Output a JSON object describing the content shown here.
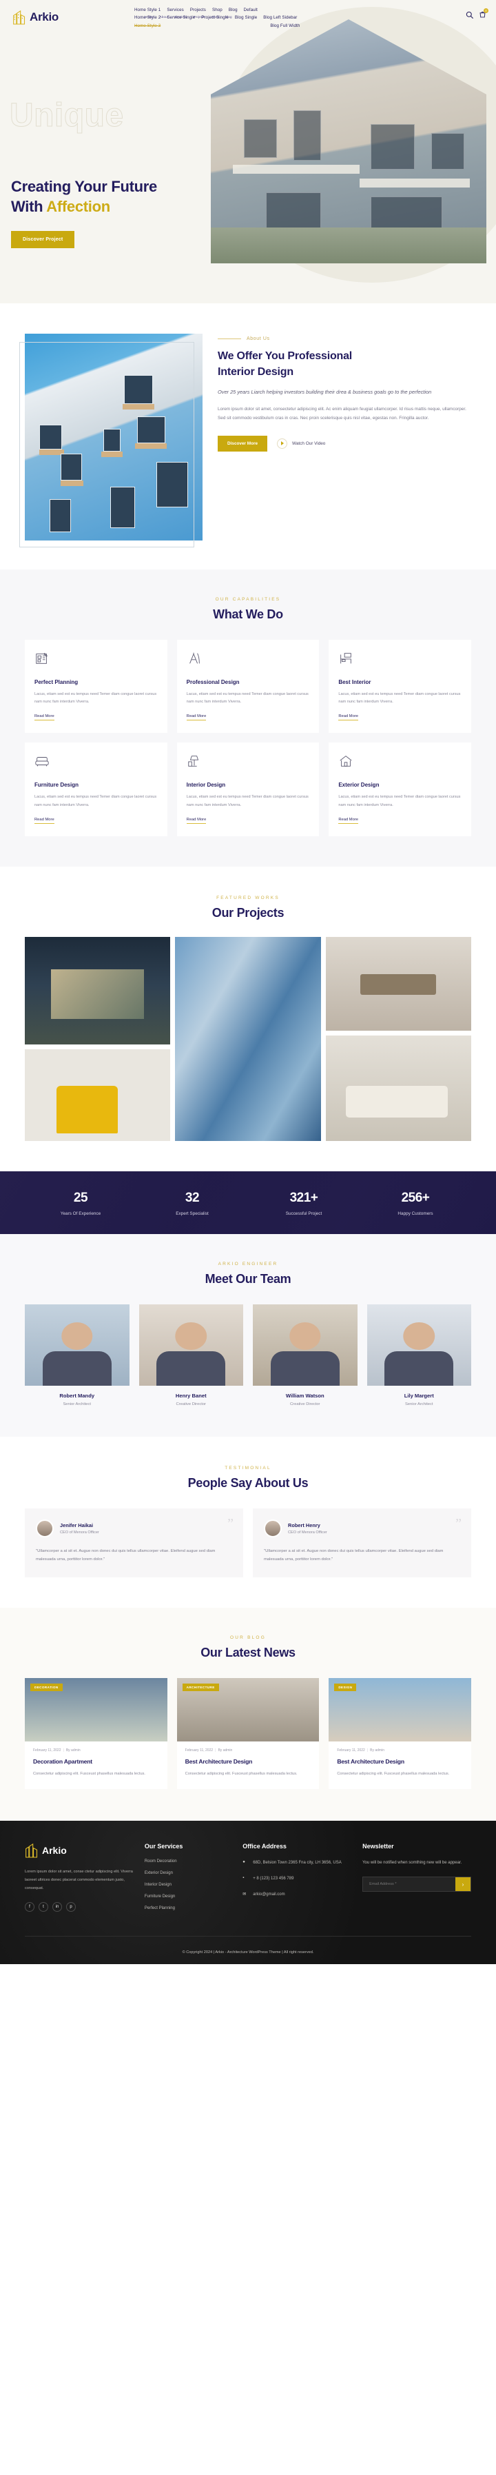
{
  "brand": {
    "name": "Arkio",
    "icon": "building-logo-icon"
  },
  "header": {
    "nav_primary": [
      "Home Style 1",
      "Services",
      "Projects",
      "Shop",
      "Blog",
      "Default"
    ],
    "nav_secondary": [
      "Home Style 2",
      "Service Single",
      "Project Single",
      "Blog Single",
      "Blog Left Sidebar"
    ],
    "nav_overlay": [
      "Home",
      "About",
      "Services",
      "Projects",
      "Shop",
      "Blog"
    ],
    "nav_tertiary": [
      "Home Style 3",
      "Blog Full Width"
    ],
    "nav_extra": "Home Style 5",
    "search_icon": "search-icon",
    "cart_icon": "cart-icon",
    "cart_count": "0"
  },
  "hero": {
    "outline_word": "Unique",
    "title_line1": "Creating Your Future",
    "title_line2_plain": "With ",
    "title_line2_accent": "Affection",
    "cta": "Discover Project"
  },
  "about": {
    "eyebrow": "About Us",
    "title_line1": "We Offer You Professional",
    "title_line2": "Interior Design",
    "lead": "Over 25 years Liarch helping investors building their drea & business goals go to the perfection",
    "body": "Lorem ipsum dolor sit amet, consectetur adipiscing elit. Ac enim aliquam feugiat ullamcorper. Id risus mattis neque, ullamcorper. Sed sit commodo vestibulum cras in cras. Nec proin scelerisque quis nisl vitae, egestas non. Fringilla auctor.",
    "cta": "Discover More",
    "video_label": "Watch Our Video",
    "play_icon": "play-icon"
  },
  "capabilities": {
    "eyebrow": "OUR CAPABILITIES",
    "title": "What We Do",
    "read_more": "Read More",
    "body": "Lacus, etiam sed est eu tempus need Temer diam congue laoret cursus nam nunc fam interdum Viverra.",
    "cards": [
      {
        "title": "Perfect Planning",
        "icon": "blueprint-icon"
      },
      {
        "title": "Professional Design",
        "icon": "compass-icon"
      },
      {
        "title": "Best Interior",
        "icon": "bed-icon"
      },
      {
        "title": "Furniture Design",
        "icon": "sofa-icon"
      },
      {
        "title": "Interior Design",
        "icon": "lamp-icon"
      },
      {
        "title": "Exterior Design",
        "icon": "house-icon"
      }
    ]
  },
  "projects": {
    "eyebrow": "FEATURED WORKS",
    "title": "Our Projects",
    "tiles": [
      {
        "name": "modern-house-night",
        "style": "t-house"
      },
      {
        "name": "yellow-armchair-room",
        "style": "t-yellow"
      },
      {
        "name": "glass-skyscraper",
        "style": "t-glass"
      },
      {
        "name": "dining-room",
        "style": "t-dining"
      },
      {
        "name": "living-room",
        "style": "t-living"
      }
    ]
  },
  "counters": [
    {
      "value": "25",
      "label": "Years Of Experience"
    },
    {
      "value": "32",
      "label": "Expert Specialist"
    },
    {
      "value": "321+",
      "label": "Successful Project"
    },
    {
      "value": "256+",
      "label": "Happy Customers"
    }
  ],
  "team": {
    "eyebrow": "ARKIO ENGINEER",
    "title": "Meet Our Team",
    "members": [
      {
        "name": "Robert Mandy",
        "role": "Senior Architect",
        "photo": "tp1"
      },
      {
        "name": "Henry Banet",
        "role": "Creative Director",
        "photo": "tp2"
      },
      {
        "name": "William Watson",
        "role": "Creative Director",
        "photo": "tp3"
      },
      {
        "name": "Lily Margert",
        "role": "Senior Architect",
        "photo": "tp4"
      }
    ]
  },
  "testimonial": {
    "eyebrow": "TESTIMONIAL",
    "title": "People Say About Us",
    "quote_icon": "quote-icon",
    "items": [
      {
        "name": "Jenifer Haikai",
        "role": "CEO of Menora Officer",
        "text": "\"Ullamcorper a at sit et. Augue non donec dui quis tellus ullamcorper vitae. Eleifend augue sed diam malesuada urna, porttitor lorem dolor.\""
      },
      {
        "name": "Robert Henry",
        "role": "CEO of Menora Officer",
        "text": "\"Ullamcorper a at sit et. Augue non donec dui quis tellus ullamcorper vitae. Eleifend augue sed diam malesuada urna, porttitor lorem dolor.\""
      }
    ]
  },
  "news": {
    "eyebrow": "OUR BLOG",
    "title": "Our Latest News",
    "posts": [
      {
        "tag": "DECORATION",
        "date": "February 11, 2022",
        "author": "By admin",
        "title": "Decoration Apartment",
        "excerpt": "Consectetur adipiscing elit. Fusceust phasellus malesuada lectus.",
        "thumb": "nt1"
      },
      {
        "tag": "ARCHITECTURE",
        "date": "February 11, 2022",
        "author": "By admin",
        "title": "Best Architecture Design",
        "excerpt": "Consectetur adipiscing elit. Fusceust phasellus malesuada lectus.",
        "thumb": "nt2"
      },
      {
        "tag": "DESIGN",
        "date": "February 11, 2022",
        "author": "By admin",
        "title": "Best Architecture Design",
        "excerpt": "Consectetur adipiscing elit. Fusceust phasellus malesuada lectus.",
        "thumb": "nt3"
      }
    ]
  },
  "footer": {
    "brand": "Arkio",
    "about": "Lorem ipsum dolor sit amet, conse ctetur adipiscing elit. Viverra laoreet ultrices donec placerat commodo elementum justo, consequat.",
    "socials": [
      "f",
      "t",
      "in",
      "p"
    ],
    "services_heading": "Our Services",
    "services": [
      "Room Decoration",
      "Exterior Design",
      "Interior Design",
      "Furniture Design",
      "Perfect Planning"
    ],
    "address_heading": "Office Address",
    "address": "68D, Belsion Town 2365 Fna city, LH 3656, USA",
    "phone": "+ 8 (123) 123 456 789",
    "email": "arkio@gmail.com",
    "newsletter_heading": "Newsletter",
    "newsletter_note": "You will be notified when somthing new will be appear.",
    "email_placeholder": "Email Address *",
    "email_value": "",
    "submit_icon": "arrow-right-icon",
    "copyright": "© Copyright 2024 | Arkio - Architecture WordPress Theme | All right reserved."
  },
  "colors": {
    "gold": "#c9a90f",
    "navy": "#241d5e",
    "dark": "#171717"
  }
}
